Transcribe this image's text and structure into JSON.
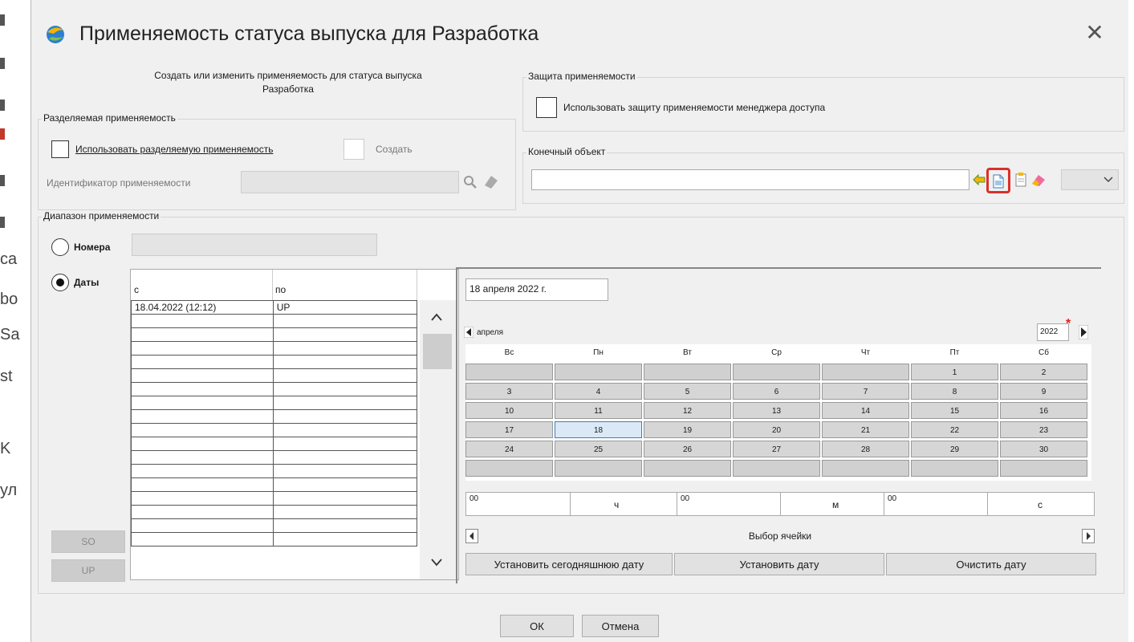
{
  "background": {
    "left_text": [
      "са",
      "bo",
      "Sa",
      "st",
      "K",
      "ул"
    ]
  },
  "dialog": {
    "title": "Применяемость статуса выпуска для Разработка",
    "close": "✕",
    "create_description_line1": "Создать или изменить применяемость для статуса выпуска",
    "create_description_line2": "Разработка"
  },
  "shared": {
    "legend": "Разделяемая применяемость",
    "use_shared_label": "Использовать разделяемую применяемость",
    "create_label": "Создать",
    "identifier_label": "Идентификатор применяемости",
    "identifier_value": ""
  },
  "protection": {
    "legend": "Защита применяемости",
    "use_protection_label": "Использовать защиту применяемости менеджера доступа"
  },
  "target": {
    "legend": "Конечный объект",
    "value": "",
    "select_value": ""
  },
  "range": {
    "legend": "Диапазон применяемости",
    "numbers_label": "Номера",
    "numbers_value": "",
    "dates_label": "Даты",
    "so_button": "SO",
    "up_button": "UP",
    "table": {
      "headers": [
        "с",
        "по"
      ],
      "rows": [
        [
          "18.04.2022  (12:12)",
          "UP"
        ],
        [
          "",
          ""
        ],
        [
          "",
          ""
        ],
        [
          "",
          ""
        ],
        [
          "",
          ""
        ],
        [
          "",
          ""
        ],
        [
          "",
          ""
        ],
        [
          "",
          ""
        ],
        [
          "",
          ""
        ],
        [
          "",
          ""
        ],
        [
          "",
          ""
        ],
        [
          "",
          ""
        ],
        [
          "",
          ""
        ],
        [
          "",
          ""
        ],
        [
          "",
          ""
        ],
        [
          "",
          ""
        ],
        [
          "",
          ""
        ],
        [
          "",
          ""
        ]
      ]
    }
  },
  "calendar": {
    "date_display": "18 апреля 2022 г.",
    "month_label": "апреля",
    "year": "2022",
    "required_mark": "*",
    "weekdays": [
      "Вс",
      "Пн",
      "Вт",
      "Ср",
      "Чт",
      "Пт",
      "Сб"
    ],
    "weeks": [
      [
        "",
        "",
        "",
        "",
        "",
        "1",
        "2"
      ],
      [
        "3",
        "4",
        "5",
        "6",
        "7",
        "8",
        "9"
      ],
      [
        "10",
        "11",
        "12",
        "13",
        "14",
        "15",
        "16"
      ],
      [
        "17",
        "18",
        "19",
        "20",
        "21",
        "22",
        "23"
      ],
      [
        "24",
        "25",
        "26",
        "27",
        "28",
        "29",
        "30"
      ],
      [
        "",
        "",
        "",
        "",
        "",
        "",
        ""
      ]
    ],
    "selected_day": "18",
    "hours": "00",
    "hours_unit": "ч",
    "minutes": "00",
    "minutes_unit": "м",
    "seconds": "00",
    "seconds_unit": "с",
    "scroll_label": "Выбор ячейки",
    "set_today": "Установить сегодняшнюю дату",
    "set_date": "Установить дату",
    "clear_date": "Очистить дату"
  },
  "footer": {
    "ok": "ОК",
    "cancel": "Отмена"
  },
  "colors": {
    "highlight_border": "#d9302c",
    "selected_day_border": "#3a7ebf"
  }
}
